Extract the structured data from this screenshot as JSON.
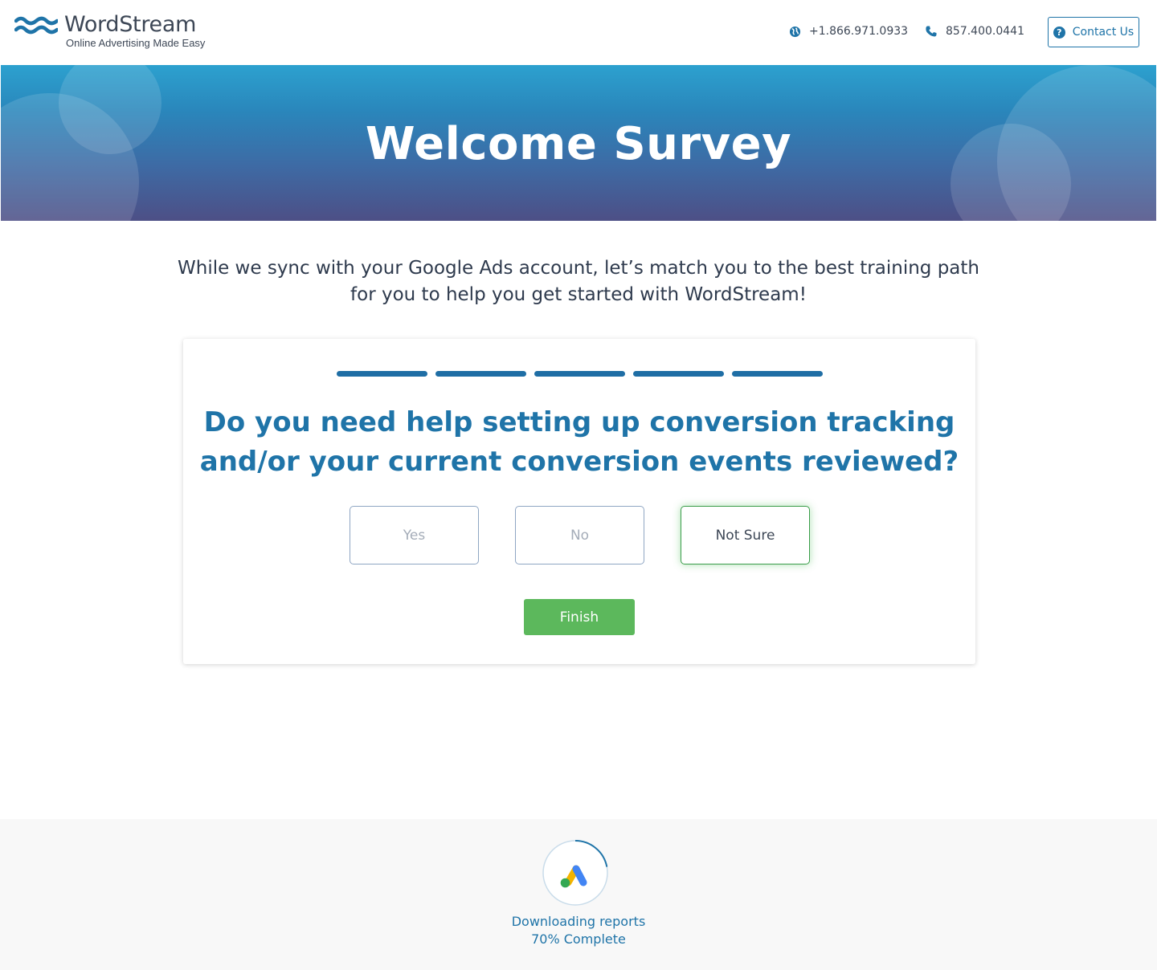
{
  "header": {
    "brand_name": "WordStream",
    "brand_tagline": "Online Advertising Made Easy",
    "phone_international": "+1.866.971.0933",
    "phone_local": "857.400.0441",
    "contact_label": "Contact Us",
    "contact_icon_glyph": "?"
  },
  "hero": {
    "title": "Welcome Survey"
  },
  "intro": {
    "line1": "While we sync with your Google Ads account, let’s match you to the best training path",
    "line2": "for you to help you get started with WordStream!"
  },
  "survey": {
    "progress": {
      "completed_steps": 5,
      "total_steps": 5
    },
    "question_line1": "Do you need help setting up conversion tracking",
    "question_line2": "and/or your current conversion events reviewed?",
    "options": [
      {
        "label": "Yes",
        "selected": false
      },
      {
        "label": "No",
        "selected": false
      },
      {
        "label": "Not Sure",
        "selected": true
      }
    ],
    "finish_label": "Finish"
  },
  "sync_status": {
    "activity": "Downloading reports",
    "progress_text": "70% Complete",
    "progress_percent": 70
  },
  "colors": {
    "brand_blue": "#1f74a8",
    "finish_green": "#5cb85c",
    "selected_border": "#3a9d4a"
  }
}
